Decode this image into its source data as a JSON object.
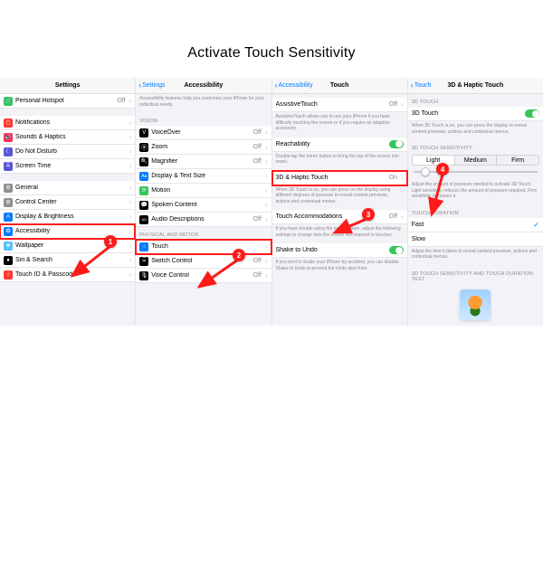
{
  "title": "Activate Touch Sensitivity",
  "callouts": [
    "1",
    "2",
    "3",
    "4"
  ],
  "panel1": {
    "nav_title": "Settings",
    "items_top": [
      {
        "icon": "🔗",
        "bg": "#34c759",
        "label": "Personal Hotspot",
        "value": "Off"
      }
    ],
    "items_mid": [
      {
        "icon": "◻︎",
        "bg": "#ff3b30",
        "label": "Notifications"
      },
      {
        "icon": "🔊",
        "bg": "#ff2d55",
        "label": "Sounds & Haptics"
      },
      {
        "icon": "☾",
        "bg": "#5856d6",
        "label": "Do Not Disturb"
      },
      {
        "icon": "⌛︎",
        "bg": "#5856d6",
        "label": "Screen Time"
      }
    ],
    "items_low": [
      {
        "icon": "⚙︎",
        "bg": "#8e8e93",
        "label": "General"
      },
      {
        "icon": "�ʘ",
        "bg": "#8e8e93",
        "label": "Control Center"
      },
      {
        "icon": "A",
        "bg": "#007aff",
        "label": "Display & Brightness"
      },
      {
        "icon": "✪",
        "bg": "#007aff",
        "label": "Accessibility",
        "highlight": true
      },
      {
        "icon": "❀",
        "bg": "#55c1ff",
        "label": "Wallpaper"
      },
      {
        "icon": "●",
        "bg": "#000",
        "label": "Siri & Search"
      },
      {
        "icon": "☝︎",
        "bg": "#ff3b30",
        "label": "Touch ID & Passcode"
      }
    ]
  },
  "panel2": {
    "back": "Settings",
    "nav_title": "Accessibility",
    "intro": "Accessibility features help you customize your iPhone for your individual needs.",
    "vision_header": "VISION",
    "vision": [
      {
        "icon": "V",
        "bg": "#000",
        "label": "VoiceOver",
        "value": "Off"
      },
      {
        "icon": "⦿",
        "bg": "#000",
        "label": "Zoom",
        "value": "Off"
      },
      {
        "icon": "🔍",
        "bg": "#000",
        "label": "Magnifier",
        "value": "Off"
      },
      {
        "icon": "Aa",
        "bg": "#007aff",
        "label": "Display & Text Size"
      },
      {
        "icon": "⟳",
        "bg": "#34c759",
        "label": "Motion"
      },
      {
        "icon": "💬",
        "bg": "#000",
        "label": "Spoken Content"
      },
      {
        "icon": "AD",
        "bg": "#000",
        "label": "Audio Descriptions",
        "value": "Off"
      }
    ],
    "motor_header": "PHYSICAL AND MOTOR",
    "motor": [
      {
        "icon": "☝︎",
        "bg": "#007aff",
        "label": "Touch",
        "highlight": true
      },
      {
        "icon": "⌺",
        "bg": "#000",
        "label": "Switch Control",
        "value": "Off"
      },
      {
        "icon": "🎙",
        "bg": "#000",
        "label": "Voice Control",
        "value": "Off"
      }
    ]
  },
  "panel3": {
    "back": "Accessibility",
    "nav_title": "Touch",
    "at_label": "AssistiveTouch",
    "at_value": "Off",
    "at_desc": "AssistiveTouch allows you to use your iPhone if you have difficulty touching the screen or if you require an adaptive accessory.",
    "reach_label": "Reachability",
    "reach_desc": "Double-tap the home button to bring the top of the screen into reach.",
    "haptic_label": "3D & Haptic Touch",
    "haptic_value": "On",
    "haptic_desc": "When 3D Touch is on, you can press on the display using different degrees of pressure to reveal content previews, actions and contextual menus.",
    "accom_label": "Touch Accommodations",
    "accom_value": "Off",
    "accom_desc": "If you have trouble using the touch screen, adjust the following settings to change how the screen will respond to touches.",
    "shake_label": "Shake to Undo",
    "shake_desc": "If you tend to shake your iPhone by accident, you can disable Shake to Undo to prevent the Undo alert from"
  },
  "panel4": {
    "back": "Touch",
    "nav_title": "3D & Haptic Touch",
    "t3d_header": "3D TOUCH",
    "t3d_label": "3D Touch",
    "t3d_desc": "When 3D Touch is on, you can press the display to reveal content previews, actions and contextual menus.",
    "sens_header": "3D TOUCH SENSITIVITY",
    "seg": [
      "Light",
      "Medium",
      "Firm"
    ],
    "sens_desc": "Adjust the amount of pressure needed to activate 3D Touch. Light sensitivity reduces the amount of pressure required. Firm sensitivity increases it.",
    "dur_header": "TOUCH DURATION",
    "dur_fast": "Fast",
    "dur_slow": "Slow",
    "dur_desc": "Adjust the time it takes to reveal content previews, actions and contextual menus.",
    "test_header": "3D TOUCH SENSITIVITY AND TOUCH DURATION TEST"
  }
}
